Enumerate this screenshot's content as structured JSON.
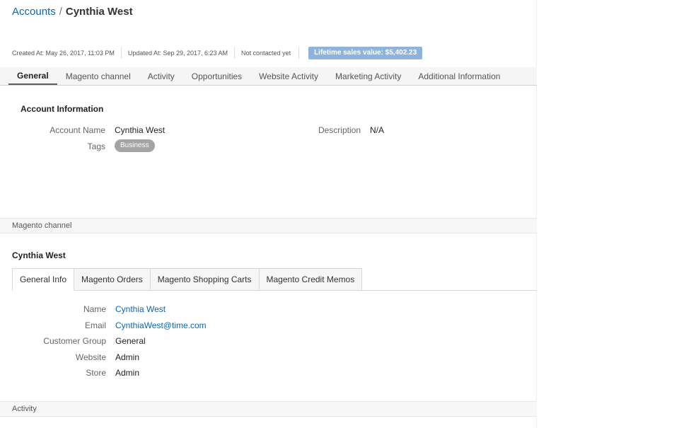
{
  "breadcrumb": {
    "parent": "Accounts",
    "separator": "/",
    "current": "Cynthia West"
  },
  "meta": {
    "created": "Created At: May 26, 2017, 11:03 PM",
    "updated": "Updated At: Sep 29, 2017, 6:23 AM",
    "contacted": "Not contacted yet",
    "lifetime": "Lifetime sales value: $5,402.23"
  },
  "main_tabs": [
    "General",
    "Magento channel",
    "Activity",
    "Opportunities",
    "Website Activity",
    "Marketing Activity",
    "Additional Information"
  ],
  "account_info": {
    "title": "Account Information",
    "account_name_label": "Account Name",
    "account_name_value": "Cynthia West",
    "tags_label": "Tags",
    "tag": "Business",
    "description_label": "Description",
    "description_value": "N/A"
  },
  "magento_section": {
    "bar_label": "Magento channel",
    "customer_title": "Cynthia West",
    "sub_tabs": [
      "General Info",
      "Magento Orders",
      "Magento Shopping Carts",
      "Magento Credit Memos"
    ],
    "fields": {
      "name_label": "Name",
      "name_value": "Cynthia West",
      "email_label": "Email",
      "email_value": "CynthiaWest@time.com",
      "group_label": "Customer Group",
      "group_value": "General",
      "website_label": "Website",
      "website_value": "Admin",
      "store_label": "Store",
      "store_value": "Admin"
    }
  },
  "activity_section": {
    "bar_label": "Activity"
  },
  "colors": {
    "link": "#0c64b5",
    "lifetime_badge": "#8fb4dc",
    "tag_pill": "#a4a4a4"
  }
}
